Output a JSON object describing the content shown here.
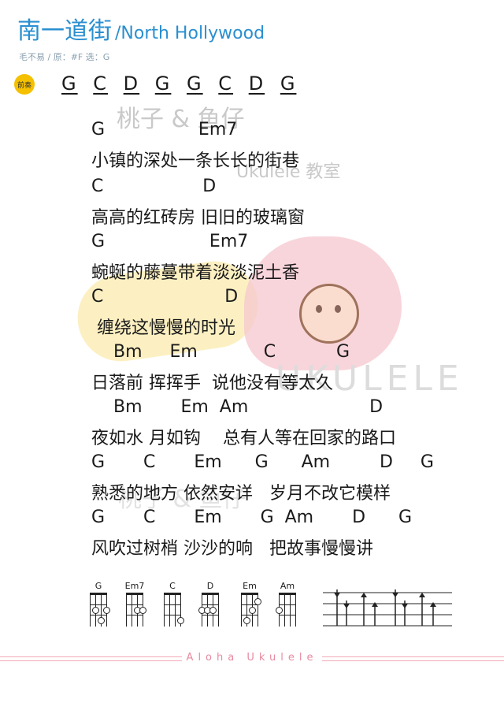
{
  "header": {
    "title": "南一道街",
    "subtitle": "/North Hollywood",
    "meta": "毛不易 / 原：#F 选：G"
  },
  "intro": {
    "badge": "前奏",
    "chords": [
      "G",
      "C",
      "D",
      "G",
      "G",
      "C",
      "D",
      "G"
    ]
  },
  "watermark": {
    "line1": "桃子 & 鱼仔",
    "line2": "Ukulele 教室",
    "line3": "UKULELE"
  },
  "song": {
    "lines": [
      {
        "chords": "G                 Em7",
        "lyric": "小镇的深处一条长长的街巷"
      },
      {
        "chords": "C                  D",
        "lyric": "高高的红砖房 旧旧的玻璃窗"
      },
      {
        "chords": "G                   Em7",
        "lyric": "蜿蜒的藤蔓带着淡淡泥土香"
      },
      {
        "chords": "C                      D",
        "lyric": " 缠绕这慢慢的时光"
      },
      {
        "chords": "    Bm     Em            C           G",
        "lyric": "日落前 挥挥手  说他没有等太久"
      },
      {
        "chords": "    Bm       Em  Am                      D",
        "lyric": "夜如水 月如钩    总有人等在回家的路口"
      },
      {
        "chords": "G       C       Em      G      Am         D     G",
        "lyric": "熟悉的地方 依然安详   岁月不改它模样"
      },
      {
        "chords": "G       C       Em       G  Am       D      G",
        "lyric": "风吹过树梢 沙沙的响   把故事慢慢讲"
      }
    ]
  },
  "chord_diagrams": [
    {
      "name": "G"
    },
    {
      "name": "Em7"
    },
    {
      "name": "C"
    },
    {
      "name": "D"
    },
    {
      "name": "Em"
    },
    {
      "name": "Am"
    }
  ],
  "footer": {
    "text": "Aloha Ukulele"
  },
  "colors": {
    "title": "#2a8fd0",
    "footer": "#e88aa0",
    "badge": "#f4c000"
  }
}
